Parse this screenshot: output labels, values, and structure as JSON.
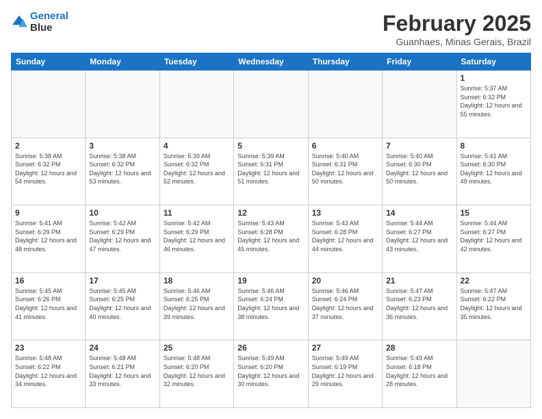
{
  "header": {
    "logo_line1": "General",
    "logo_line2": "Blue",
    "title": "February 2025",
    "subtitle": "Guanhaes, Minas Gerais, Brazil"
  },
  "days_of_week": [
    "Sunday",
    "Monday",
    "Tuesday",
    "Wednesday",
    "Thursday",
    "Friday",
    "Saturday"
  ],
  "weeks": [
    [
      {
        "day": "",
        "info": ""
      },
      {
        "day": "",
        "info": ""
      },
      {
        "day": "",
        "info": ""
      },
      {
        "day": "",
        "info": ""
      },
      {
        "day": "",
        "info": ""
      },
      {
        "day": "",
        "info": ""
      },
      {
        "day": "1",
        "info": "Sunrise: 5:37 AM\nSunset: 6:32 PM\nDaylight: 12 hours and 55 minutes."
      }
    ],
    [
      {
        "day": "2",
        "info": "Sunrise: 5:38 AM\nSunset: 6:32 PM\nDaylight: 12 hours and 54 minutes."
      },
      {
        "day": "3",
        "info": "Sunrise: 5:38 AM\nSunset: 6:32 PM\nDaylight: 12 hours and 53 minutes."
      },
      {
        "day": "4",
        "info": "Sunrise: 5:39 AM\nSunset: 6:32 PM\nDaylight: 12 hours and 52 minutes."
      },
      {
        "day": "5",
        "info": "Sunrise: 5:39 AM\nSunset: 6:31 PM\nDaylight: 12 hours and 51 minutes."
      },
      {
        "day": "6",
        "info": "Sunrise: 5:40 AM\nSunset: 6:31 PM\nDaylight: 12 hours and 50 minutes."
      },
      {
        "day": "7",
        "info": "Sunrise: 5:40 AM\nSunset: 6:30 PM\nDaylight: 12 hours and 50 minutes."
      },
      {
        "day": "8",
        "info": "Sunrise: 5:41 AM\nSunset: 6:30 PM\nDaylight: 12 hours and 49 minutes."
      }
    ],
    [
      {
        "day": "9",
        "info": "Sunrise: 5:41 AM\nSunset: 6:29 PM\nDaylight: 12 hours and 48 minutes."
      },
      {
        "day": "10",
        "info": "Sunrise: 5:42 AM\nSunset: 6:29 PM\nDaylight: 12 hours and 47 minutes."
      },
      {
        "day": "11",
        "info": "Sunrise: 5:42 AM\nSunset: 6:29 PM\nDaylight: 12 hours and 46 minutes."
      },
      {
        "day": "12",
        "info": "Sunrise: 5:43 AM\nSunset: 6:28 PM\nDaylight: 12 hours and 45 minutes."
      },
      {
        "day": "13",
        "info": "Sunrise: 5:43 AM\nSunset: 6:28 PM\nDaylight: 12 hours and 44 minutes."
      },
      {
        "day": "14",
        "info": "Sunrise: 5:44 AM\nSunset: 6:27 PM\nDaylight: 12 hours and 43 minutes."
      },
      {
        "day": "15",
        "info": "Sunrise: 5:44 AM\nSunset: 6:27 PM\nDaylight: 12 hours and 42 minutes."
      }
    ],
    [
      {
        "day": "16",
        "info": "Sunrise: 5:45 AM\nSunset: 6:26 PM\nDaylight: 12 hours and 41 minutes."
      },
      {
        "day": "17",
        "info": "Sunrise: 5:45 AM\nSunset: 6:25 PM\nDaylight: 12 hours and 40 minutes."
      },
      {
        "day": "18",
        "info": "Sunrise: 5:46 AM\nSunset: 6:25 PM\nDaylight: 12 hours and 39 minutes."
      },
      {
        "day": "19",
        "info": "Sunrise: 5:46 AM\nSunset: 6:24 PM\nDaylight: 12 hours and 38 minutes."
      },
      {
        "day": "20",
        "info": "Sunrise: 5:46 AM\nSunset: 6:24 PM\nDaylight: 12 hours and 37 minutes."
      },
      {
        "day": "21",
        "info": "Sunrise: 5:47 AM\nSunset: 6:23 PM\nDaylight: 12 hours and 36 minutes."
      },
      {
        "day": "22",
        "info": "Sunrise: 5:47 AM\nSunset: 6:22 PM\nDaylight: 12 hours and 35 minutes."
      }
    ],
    [
      {
        "day": "23",
        "info": "Sunrise: 5:48 AM\nSunset: 6:22 PM\nDaylight: 12 hours and 34 minutes."
      },
      {
        "day": "24",
        "info": "Sunrise: 5:48 AM\nSunset: 6:21 PM\nDaylight: 12 hours and 33 minutes."
      },
      {
        "day": "25",
        "info": "Sunrise: 5:48 AM\nSunset: 6:20 PM\nDaylight: 12 hours and 32 minutes."
      },
      {
        "day": "26",
        "info": "Sunrise: 5:49 AM\nSunset: 6:20 PM\nDaylight: 12 hours and 30 minutes."
      },
      {
        "day": "27",
        "info": "Sunrise: 5:49 AM\nSunset: 6:19 PM\nDaylight: 12 hours and 29 minutes."
      },
      {
        "day": "28",
        "info": "Sunrise: 5:49 AM\nSunset: 6:18 PM\nDaylight: 12 hours and 28 minutes."
      },
      {
        "day": "",
        "info": ""
      }
    ]
  ]
}
